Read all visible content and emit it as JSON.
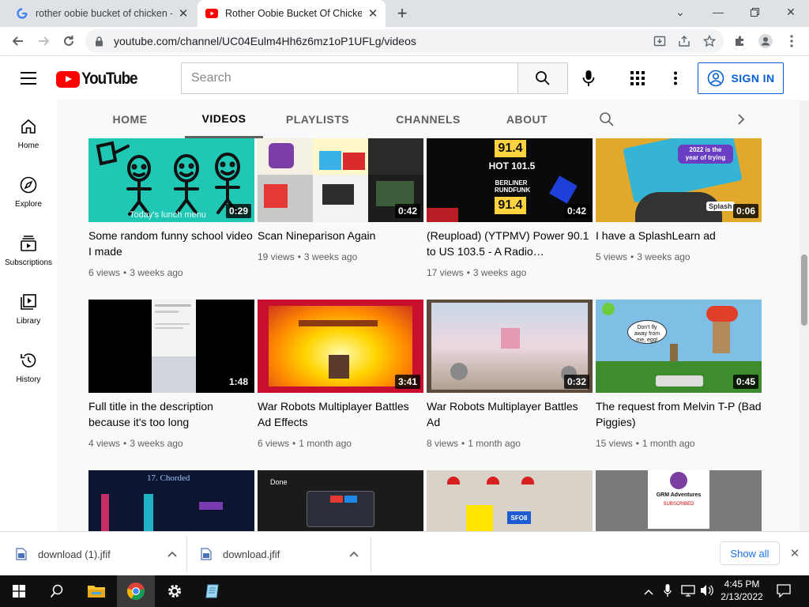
{
  "browser": {
    "tabs": [
      {
        "title": "rother oobie bucket of chicken -",
        "active": false,
        "icon": "google-g-icon"
      },
      {
        "title": "Rother Oobie Bucket Of Chicken",
        "active": true,
        "icon": "youtube-icon"
      }
    ],
    "url": "youtube.com/channel/UC04Eulm4Hh6z6mz1oP1UFLg/videos"
  },
  "youtube": {
    "logo_text": "YouTube",
    "search_placeholder": "Search",
    "signin_label": "SIGN IN",
    "accent": "#065fd4",
    "brand_red": "#ff0000"
  },
  "sidebar": {
    "items": [
      {
        "label": "Home",
        "icon": "home-icon"
      },
      {
        "label": "Explore",
        "icon": "compass-icon"
      },
      {
        "label": "Subscriptions",
        "icon": "subscriptions-icon"
      },
      {
        "label": "Library",
        "icon": "library-icon"
      },
      {
        "label": "History",
        "icon": "history-icon"
      }
    ]
  },
  "channel_tabs": [
    {
      "label": "HOME"
    },
    {
      "label": "VIDEOS",
      "active": true
    },
    {
      "label": "PLAYLISTS"
    },
    {
      "label": "CHANNELS"
    },
    {
      "label": "ABOUT"
    }
  ],
  "videos": [
    {
      "title": "Some random funny school video I made",
      "views": "6 views",
      "age": "3 weeks ago",
      "duration": "0:29",
      "thumb_caption": "Today's lunch menu"
    },
    {
      "title": "Scan Nineparison Again",
      "views": "19 views",
      "age": "3 weeks ago",
      "duration": "0:42"
    },
    {
      "title": "(Reupload) (YTPMV) Power 90.1 to US 103.5 - A Radio…",
      "views": "17 views",
      "age": "3 weeks ago",
      "duration": "0:42",
      "thumb_text": {
        "top": "91.4",
        "hot": "HOT 101.5",
        "mid1": "BERLINER",
        "mid2": "RUNDFUNK",
        "bottom": "91.4"
      }
    },
    {
      "title": "I have a SplashLearn ad",
      "views": "5 views",
      "age": "3 weeks ago",
      "duration": "0:06",
      "thumb_text": {
        "banner1": "2022 is the",
        "banner2": "year of trying",
        "brand": "Splash"
      }
    },
    {
      "title": "Full title in the description because it's too long",
      "views": "4 views",
      "age": "3 weeks ago",
      "duration": "1:48"
    },
    {
      "title": "War Robots Multiplayer Battles Ad Effects",
      "views": "6 views",
      "age": "1 month ago",
      "duration": "3:41"
    },
    {
      "title": "War Robots Multiplayer Battles Ad",
      "views": "8 views",
      "age": "1 month ago",
      "duration": "0:32"
    },
    {
      "title": "The request from Melvin T-P (Bad Piggies)",
      "views": "15 views",
      "age": "1 month ago",
      "duration": "0:45",
      "thumb_text": {
        "bubble1": "Don't fly",
        "bubble2": "away from",
        "bubble3": "me, egg!"
      }
    },
    {
      "thumb_caption": "17. Chorded"
    },
    {
      "thumb_caption": "Done"
    },
    {
      "thumb_caption": "SFO8"
    },
    {
      "thumb_caption": "GRM Adventures",
      "thumb_sub": "SUBSCRIBED"
    }
  ],
  "downloads": [
    {
      "name": "download (1).jfif"
    },
    {
      "name": "download.jfif"
    }
  ],
  "downloads_show_all": "Show all",
  "taskbar": {
    "time": "4:45 PM",
    "date": "2/13/2022"
  }
}
